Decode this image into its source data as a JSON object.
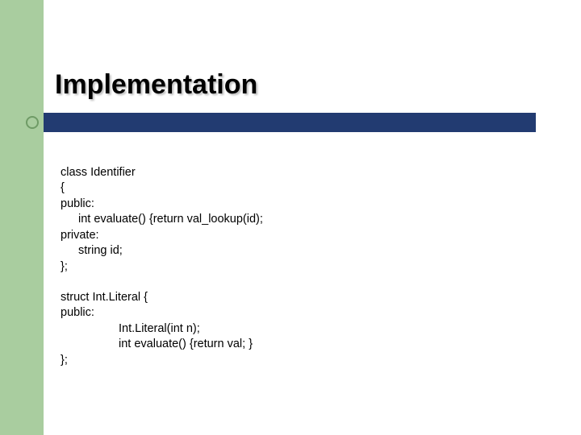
{
  "title": "Implementation",
  "code1": {
    "l1": "class Identifier",
    "l2": "{",
    "l3": "public:",
    "l4": "int evaluate() {return val_lookup(id);",
    "l5": "private:",
    "l6": "string id;",
    "l7": "};"
  },
  "code2": {
    "l1": "struct Int.Literal {",
    "l2": "public:",
    "l3": "Int.Literal(int n);",
    "l4": "int evaluate() {return val; }",
    "l5": "};"
  }
}
